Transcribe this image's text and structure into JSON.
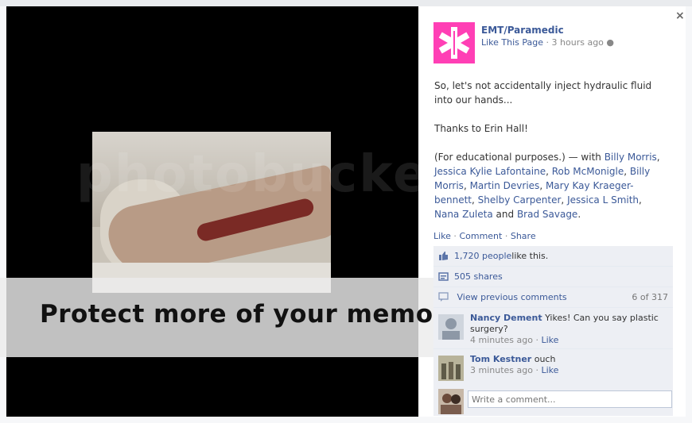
{
  "page": {
    "name": "EMT/Paramedic",
    "like_label": "Like This Page",
    "time": "3 hours ago"
  },
  "post": {
    "line1": "So, let's not accidentally inject hydraulic fluid into our hands...",
    "line2": "Thanks to Erin Hall!",
    "line3_prefix": "(For educational purposes.) — with ",
    "tagged": [
      "Billy Morris",
      "Jessica Kylie Lafontaine",
      "Rob McMonigle",
      "Billy Morris",
      "Martin Devries",
      "Mary Kay Kraeger-bennett",
      "Shelby Carpenter",
      "Jessica L Smith",
      "Nana Zuleta"
    ],
    "and_text": " and ",
    "last_tagged": "Brad Savage",
    "end": "."
  },
  "actions": {
    "like": "Like",
    "comment": "Comment",
    "share": "Share"
  },
  "ufi": {
    "likes_count": "1,720 people",
    "likes_suffix": " like this.",
    "shares": "505 shares",
    "view_previous": "View previous comments",
    "comment_count": "6 of 317"
  },
  "comments": [
    {
      "author": "Nancy Dement",
      "text": " Yikes! Can you say plastic surgery?",
      "time": "4 minutes ago",
      "like": "Like"
    },
    {
      "author": "Tom Kestner",
      "text": " ouch",
      "time": "3 minutes ago",
      "like": "Like"
    }
  ],
  "write_placeholder": "Write a comment...",
  "watermark": "Protect more of your memories for less!",
  "watermark_logo": "photobucket",
  "close_label": "×",
  "colors": {
    "brand": "#3b5998",
    "logo": "#ff3fb5"
  },
  "icons": [
    "close-icon",
    "globe-icon",
    "thumbs-up-icon",
    "share-icon",
    "comment-icon"
  ]
}
